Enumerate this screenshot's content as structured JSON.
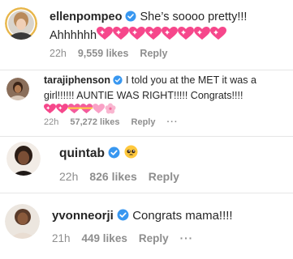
{
  "comments": [
    {
      "username": "ellenpompeo",
      "text_line1": "She’s soooo pretty!!!",
      "text_line2_prefix": "Ahhhhhh",
      "emojis": [
        "sparkling-heart-icon",
        "sparkling-heart-icon",
        "sparkling-heart-icon",
        "sparkling-heart-icon",
        "sparkling-heart-icon",
        "sparkling-heart-icon",
        "sparkling-heart-icon",
        "sparkling-heart-icon"
      ],
      "time": "22h",
      "likes": "9,559 likes",
      "reply": "Reply"
    },
    {
      "username": "tarajiphenson",
      "text_line1": "I told you at the MET it was a",
      "text_line2": "girl!!!!!! AUNTIE WAS RIGHT!!!!! Congrats!!!!",
      "emojis": [
        "sparkling-heart-icon",
        "sparkling-heart-icon",
        "heart-with-ribbon-icon",
        "heart-with-ribbon-icon",
        "pink-heart-icon",
        "cherry-blossom-icon"
      ],
      "time": "22h",
      "likes": "57,272 likes",
      "reply": "Reply",
      "more": "···"
    },
    {
      "username": "quintab",
      "emojis": [
        "pleading-face-icon"
      ],
      "time": "22h",
      "likes": "826 likes",
      "reply": "Reply"
    },
    {
      "username": "yvonneorji",
      "text": "Congrats mama!!!!",
      "time": "21h",
      "likes": "449 likes",
      "reply": "Reply",
      "more": "···"
    }
  ],
  "colors": {
    "verified": "#3897f0",
    "meta_text": "#8e8e8e",
    "heart_pink": "#f6478b",
    "divider": "#e6e6e6"
  }
}
